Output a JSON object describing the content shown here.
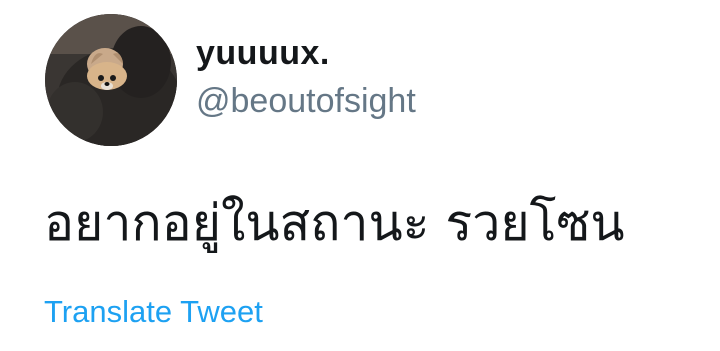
{
  "tweet": {
    "author": {
      "display_name": "yuuuux.",
      "handle": "@beoutofsight",
      "avatar_icon": "profile-photo-dog-in-hoodie"
    },
    "text": "อยากอยู่ในสถานะ รวยโซน",
    "translate_label": "Translate Tweet"
  },
  "colors": {
    "link": "#1da1f2",
    "handle": "#657786",
    "text": "#14171a"
  }
}
